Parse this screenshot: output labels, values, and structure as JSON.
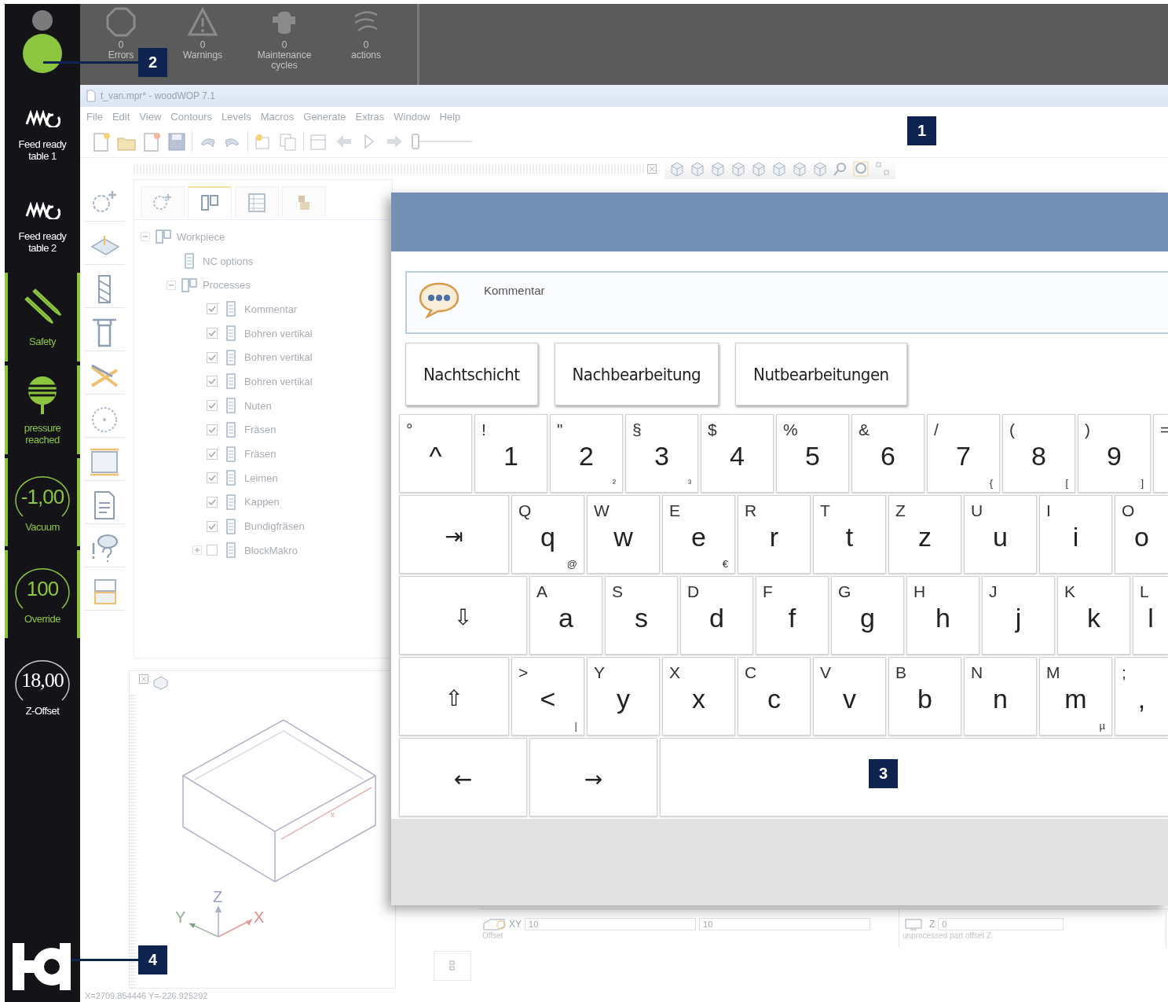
{
  "top_status": {
    "items": [
      {
        "kind": "errors",
        "count": "0",
        "label": "Errors"
      },
      {
        "kind": "warnings",
        "count": "0",
        "label": "Warnings"
      },
      {
        "kind": "maintenance",
        "count": "0",
        "label": "Maintenance cycles"
      },
      {
        "kind": "actions",
        "count": "0",
        "label": "actions"
      }
    ]
  },
  "sidebar": {
    "lights": [
      {
        "on": false
      },
      {
        "on": true
      }
    ],
    "items": [
      {
        "kind": "feed",
        "label": "Feed ready table 1",
        "active": false
      },
      {
        "kind": "feed",
        "label": "Feed ready table 2",
        "active": false
      },
      {
        "kind": "safety",
        "label": "Safety",
        "active": true
      },
      {
        "kind": "pressure",
        "label": "pressure reached",
        "active": true
      },
      {
        "kind": "gauge",
        "value": "-1,00",
        "label": "Vacuum",
        "active": true
      },
      {
        "kind": "gauge",
        "value": "100",
        "label": "Override",
        "active": true
      },
      {
        "kind": "gauge",
        "value": "18,00",
        "label": "Z-Offset",
        "active": false
      }
    ]
  },
  "window": {
    "title": "t_van.mpr* - woodWOP 7.1"
  },
  "menu": [
    "File",
    "Edit",
    "View",
    "Contours",
    "Levels",
    "Macros",
    "Generate",
    "Extras",
    "Window",
    "Help"
  ],
  "toolbar": {
    "slider": {
      "level": 0
    }
  },
  "tree_panel": {
    "tabs": [
      {
        "selected": false
      },
      {
        "selected": true
      },
      {
        "selected": false
      },
      {
        "selected": false
      }
    ],
    "tree": [
      {
        "label": "Workpiece",
        "expanded": true,
        "children": [
          {
            "label": "NC options"
          },
          {
            "label": "Processes",
            "expanded": true,
            "children": [
              {
                "label": "Kommentar",
                "checked": true
              },
              {
                "label": "Bohren vertikal",
                "checked": true
              },
              {
                "label": "Bohren vertikal",
                "checked": true
              },
              {
                "label": "Bohren vertikal",
                "checked": true
              },
              {
                "label": "Nuten",
                "checked": true
              },
              {
                "label": "Fräsen",
                "checked": true
              },
              {
                "label": "Fräsen",
                "checked": true
              },
              {
                "label": "Leimen",
                "checked": true
              },
              {
                "label": "Kappen",
                "checked": true
              },
              {
                "label": "Bundigfräsen",
                "checked": true
              },
              {
                "label": "BlockMakro",
                "checked": false,
                "expanded": false
              }
            ]
          }
        ]
      }
    ]
  },
  "view_3d": {
    "axes": [
      "X",
      "Y",
      "Z"
    ],
    "dimension_label": "x"
  },
  "parameters": {
    "fields": [
      {
        "label": "XY",
        "values": [
          "10",
          "10"
        ],
        "caption": "Offset"
      },
      {
        "label": "Z",
        "values": [
          "0"
        ],
        "caption": "unprocessed part offset Z"
      }
    ]
  },
  "status_line": "X=2709.854446 Y=-226.925292",
  "dialog": {
    "field": {
      "label": "Kommentar"
    },
    "buttons": [
      "Nachtschicht",
      "Nachbearbeitung",
      "Nutbearbeitungen"
    ],
    "keyboard": {
      "rows": [
        [
          {
            "kind": "char",
            "main": "^",
            "shift": "°"
          },
          {
            "kind": "char",
            "main": "1",
            "shift": "!"
          },
          {
            "kind": "char",
            "main": "2",
            "shift": "\"",
            "alt": "²"
          },
          {
            "kind": "char",
            "main": "3",
            "shift": "§",
            "alt": "³"
          },
          {
            "kind": "char",
            "main": "4",
            "shift": "$"
          },
          {
            "kind": "char",
            "main": "5",
            "shift": "%"
          },
          {
            "kind": "char",
            "main": "6",
            "shift": "&"
          },
          {
            "kind": "char",
            "main": "7",
            "shift": "/",
            "alt": "{"
          },
          {
            "kind": "char",
            "main": "8",
            "shift": "(",
            "alt": "["
          },
          {
            "kind": "char",
            "main": "9",
            "shift": ")",
            "alt": "]"
          },
          {
            "kind": "edge",
            "shift": "="
          }
        ],
        [
          {
            "kind": "wide",
            "main": "⇥"
          },
          {
            "kind": "char",
            "main": "q",
            "shift": "Q",
            "alt": "@"
          },
          {
            "kind": "char",
            "main": "w",
            "shift": "W"
          },
          {
            "kind": "char",
            "main": "e",
            "shift": "E",
            "alt": "€"
          },
          {
            "kind": "char",
            "main": "r",
            "shift": "R"
          },
          {
            "kind": "char",
            "main": "t",
            "shift": "T"
          },
          {
            "kind": "char",
            "main": "z",
            "shift": "Z"
          },
          {
            "kind": "char",
            "main": "u",
            "shift": "U"
          },
          {
            "kind": "char",
            "main": "i",
            "shift": "I"
          },
          {
            "kind": "edge",
            "main": "o",
            "shift": "O"
          }
        ],
        [
          {
            "kind": "wider",
            "main": "⇩"
          },
          {
            "kind": "char",
            "main": "a",
            "shift": "A"
          },
          {
            "kind": "char",
            "main": "s",
            "shift": "S"
          },
          {
            "kind": "char",
            "main": "d",
            "shift": "D"
          },
          {
            "kind": "char",
            "main": "f",
            "shift": "F"
          },
          {
            "kind": "char",
            "main": "g",
            "shift": "G"
          },
          {
            "kind": "char",
            "main": "h",
            "shift": "H"
          },
          {
            "kind": "char",
            "main": "j",
            "shift": "J"
          },
          {
            "kind": "char",
            "main": "k",
            "shift": "K"
          },
          {
            "kind": "edge",
            "main": "l",
            "shift": "L"
          }
        ],
        [
          {
            "kind": "wide",
            "main": "⇧"
          },
          {
            "kind": "char",
            "main": "<",
            "shift": ">",
            "alt": "|"
          },
          {
            "kind": "char",
            "main": "y",
            "shift": "Y"
          },
          {
            "kind": "char",
            "main": "x",
            "shift": "X"
          },
          {
            "kind": "char",
            "main": "c",
            "shift": "C"
          },
          {
            "kind": "char",
            "main": "v",
            "shift": "V"
          },
          {
            "kind": "char",
            "main": "b",
            "shift": "B"
          },
          {
            "kind": "char",
            "main": "n",
            "shift": "N"
          },
          {
            "kind": "char",
            "main": "m",
            "shift": "M",
            "alt": "µ"
          },
          {
            "kind": "edge",
            "main": ",",
            "shift": ";"
          }
        ],
        [
          {
            "kind": "wider",
            "main": "←"
          },
          {
            "kind": "wider",
            "main": "→"
          },
          {
            "kind": "space"
          }
        ]
      ]
    }
  },
  "callouts": [
    {
      "number": "1"
    },
    {
      "number": "2"
    },
    {
      "number": "3"
    },
    {
      "number": "4"
    }
  ]
}
